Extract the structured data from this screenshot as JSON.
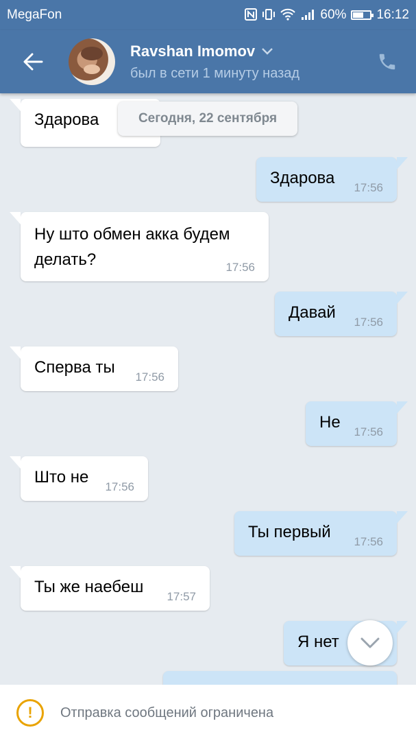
{
  "statusbar": {
    "carrier": "MegaFon",
    "battery_percent": "60%",
    "battery_level": 0.6,
    "time": "16:12",
    "icons": [
      "nfc-icon",
      "vibrate-icon",
      "wifi-icon",
      "signal-icon",
      "battery-icon"
    ]
  },
  "header": {
    "name": "Ravshan Imomov",
    "status": "был в сети 1 минуту назад",
    "icons": [
      "back-arrow-icon",
      "chevron-down-icon",
      "phone-icon"
    ]
  },
  "chat": {
    "date_label": "Сегодня, 22 сентября",
    "messages": [
      {
        "dir": "in",
        "text": "Здарова",
        "time": ""
      },
      {
        "dir": "out",
        "text": "Здарова",
        "time": "17:56"
      },
      {
        "dir": "in",
        "text": "Ну што обмен акка будем делать?",
        "time": "17:56"
      },
      {
        "dir": "out",
        "text": "Давай",
        "time": "17:56"
      },
      {
        "dir": "in",
        "text": "Сперва ты",
        "time": "17:56"
      },
      {
        "dir": "out",
        "text": "Не",
        "time": "17:56"
      },
      {
        "dir": "in",
        "text": "Што не",
        "time": "17:56"
      },
      {
        "dir": "out",
        "text": "Ты первый",
        "time": "17:56"
      },
      {
        "dir": "in",
        "text": "Ты же наебеш",
        "time": "17:57"
      },
      {
        "dir": "out",
        "text": "Я нет",
        "time": ""
      },
      {
        "dir": "out",
        "text": "",
        "time": ""
      }
    ]
  },
  "footer": {
    "text": "Отправка сообщений ограничена",
    "icon": "warning-icon",
    "accent": "#e9a300"
  },
  "colors": {
    "header": "#4a76a8",
    "background": "#e6ebf0",
    "incoming": "#ffffff",
    "outgoing": "#cce4f7"
  }
}
